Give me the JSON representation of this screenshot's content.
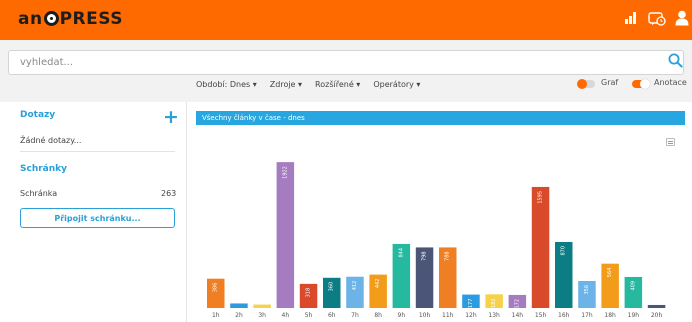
{
  "header": {
    "logo": {
      "part1": "an",
      "part2": "press"
    },
    "icons": [
      "bar-chart-icon",
      "message-clock-icon",
      "user-icon"
    ],
    "bg_color": "#ff6a00"
  },
  "search": {
    "placeholder": "vyhledat..."
  },
  "filters": {
    "items": [
      "Období: Dnes ▾",
      "Zdroje ▾",
      "Rozšířené ▾",
      "Operátory ▾"
    ]
  },
  "toggles": {
    "graf": {
      "label": "Graf",
      "on": true,
      "color": "#ff6a00"
    },
    "anotace": {
      "label": "Anotace",
      "on": false,
      "color": "#ff6a00"
    }
  },
  "sidebar": {
    "queries_title": "Dotazy",
    "queries_empty": "Žádné dotazy...",
    "boxes_title": "Schránky",
    "box_name": "Schránka",
    "box_count": "263",
    "connect_button": "Připojit schránku..."
  },
  "panel": {
    "title": "Všechny články v čase - dnes"
  },
  "chart_data": {
    "type": "bar",
    "categories": [
      "1h",
      "2h",
      "3h",
      "4h",
      "5h",
      "6h",
      "7h",
      "8h",
      "9h",
      "10h",
      "11h",
      "12h",
      "13h",
      "14h",
      "15h",
      "16h",
      "17h",
      "18h",
      "19h",
      "20h"
    ],
    "values": [
      386,
      60,
      45,
      1922,
      318,
      398,
      412,
      440,
      844,
      798,
      798,
      177,
      180,
      172,
      1595,
      870,
      356,
      584,
      409,
      40
    ],
    "labels": [
      "386",
      "",
      "",
      "1922",
      "318",
      "360",
      "412",
      "442",
      "844",
      "798",
      "788",
      "177",
      "182",
      "172",
      "1595",
      "870",
      "356",
      "564",
      "409",
      ""
    ],
    "colors": [
      "#f07f23",
      "#2d9be0",
      "#f5d24a",
      "#a67cc0",
      "#d94a2b",
      "#0d7d85",
      "#6cb3e8",
      "#f39c1a",
      "#25b9a0",
      "#4a5577",
      "#f07f23",
      "#2d9be0",
      "#f5d24a",
      "#a67cc0",
      "#d94a2b",
      "#0d7d85",
      "#6cb3e8",
      "#f39c1a",
      "#25b9a0",
      "#4a5577"
    ],
    "ylim": [
      0,
      1950
    ],
    "grid": false,
    "title": "",
    "xlabel": "",
    "ylabel": ""
  }
}
